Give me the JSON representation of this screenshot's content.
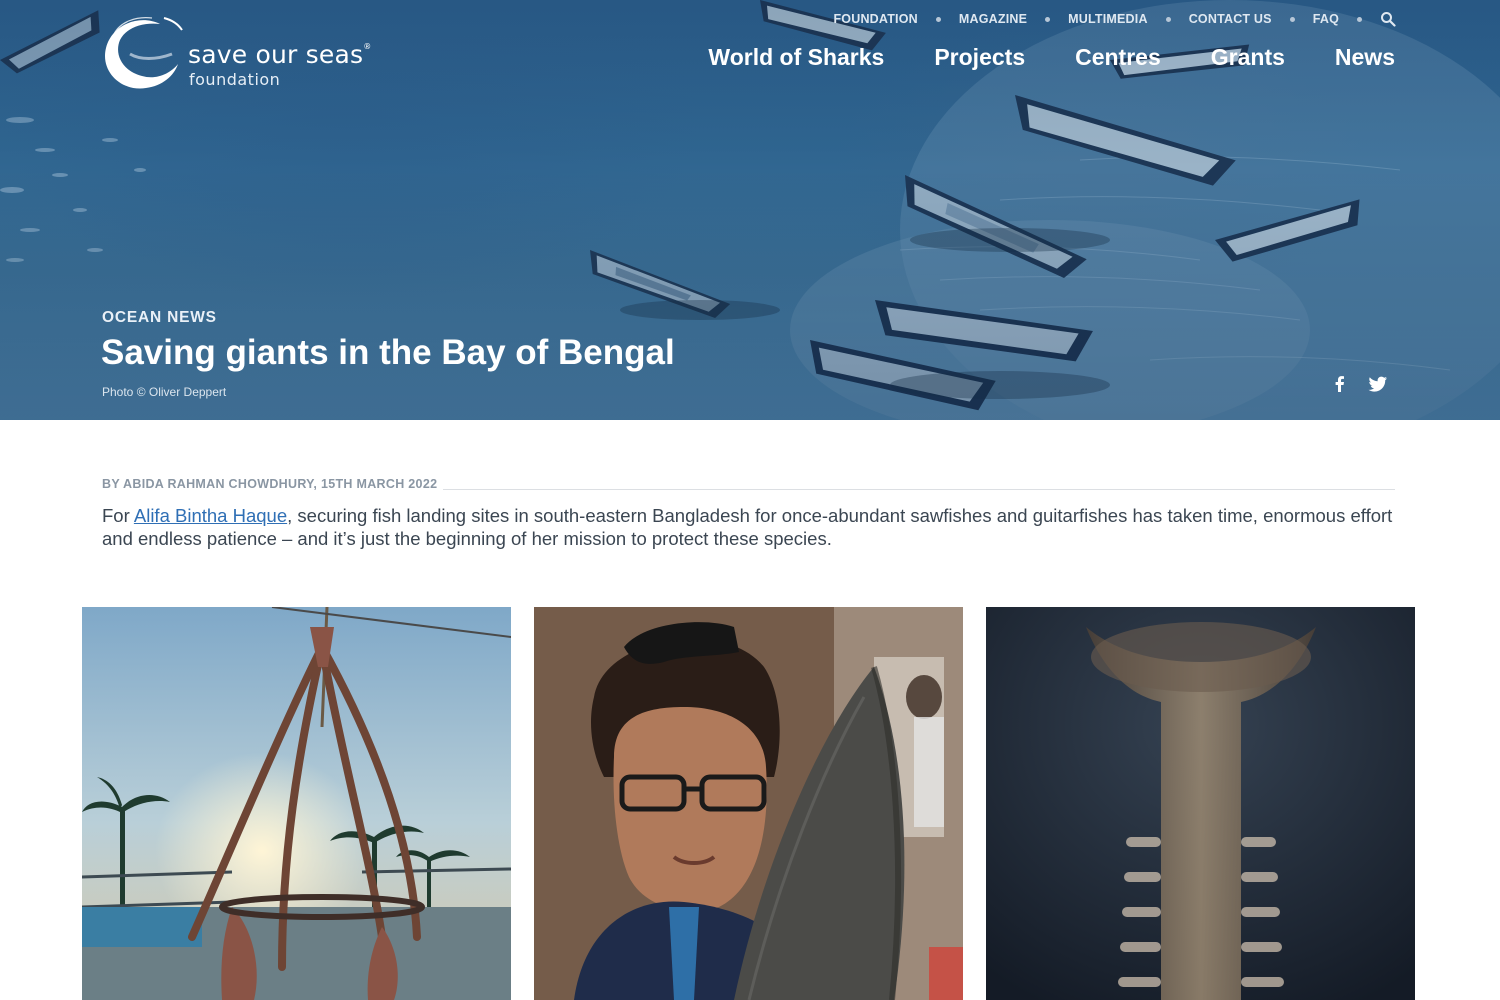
{
  "brand": {
    "name": "save our seas",
    "registered": "®",
    "subtitle": "foundation"
  },
  "utility_nav": {
    "items": [
      "FOUNDATION",
      "MAGAZINE",
      "MULTIMEDIA",
      "CONTACT US",
      "FAQ"
    ],
    "search_icon": "search-icon"
  },
  "main_nav": {
    "items": [
      "World of Sharks",
      "Projects",
      "Centres",
      "Grants",
      "News"
    ]
  },
  "hero": {
    "kicker": "OCEAN NEWS",
    "title": "Saving giants in the Bay of Bengal",
    "credit": "Photo © Oliver Deppert",
    "share_icons": [
      "facebook-icon",
      "twitter-icon"
    ]
  },
  "article": {
    "byline": "BY ABIDA RAHMAN CHOWDHURY, 15TH MARCH 2022",
    "lede_before": "For ",
    "lede_link": "Alifa Bintha Haque",
    "lede_after": ", securing fish landing sites in south-eastern Bangladesh for once-abundant sawfishes and guitarfishes has taken time, enormous effort and endless patience – and it’s just the beginning of her mission to protect these species."
  },
  "colors": {
    "hero_blue": "#2f6590",
    "link": "#2f6fb5",
    "byline": "#8a96a3",
    "body_text": "#3b4652"
  }
}
